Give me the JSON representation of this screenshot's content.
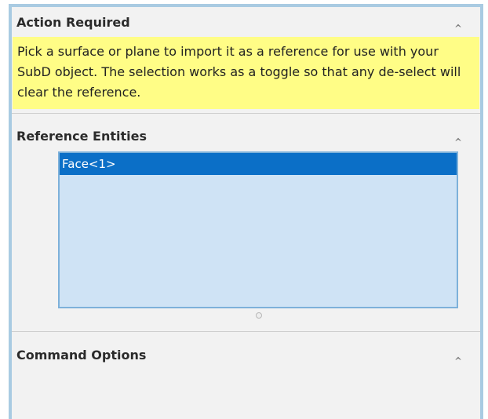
{
  "action_required": {
    "title": "Action Required",
    "chevron_icon": "chevron-up-icon",
    "message": "Pick a surface or plane to import it as a reference for use with your SubD object.  The selection works as a toggle so that any de-select will clear the reference."
  },
  "reference_entities": {
    "title": "Reference Entities",
    "chevron_icon": "chevron-up-icon",
    "items": [
      "Face<1>"
    ]
  },
  "command_options": {
    "title": "Command Options",
    "chevron_icon": "chevron-up-icon"
  },
  "colors": {
    "panel_border": "#a9cbe2",
    "message_bg": "#fffd86",
    "list_bg": "#cfe3f5",
    "selected_item_bg": "#0b6fc7"
  }
}
